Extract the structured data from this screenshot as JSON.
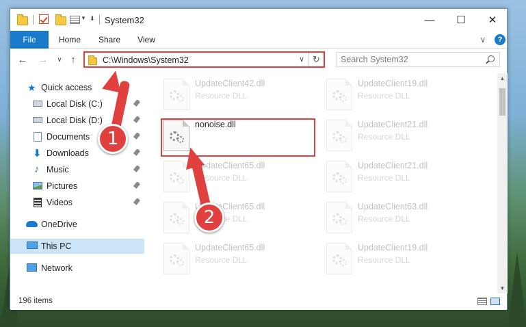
{
  "window": {
    "title": "System32",
    "controls": {
      "minimize": "—",
      "maximize": "☐",
      "close": "✕"
    }
  },
  "ribbon": {
    "tabs": [
      "File",
      "Home",
      "Share",
      "View"
    ],
    "collapse": "∨",
    "help": "?"
  },
  "nav": {
    "back": "←",
    "forward": "→",
    "recent": "∨",
    "up": "↑",
    "address": "C:\\Windows\\System32",
    "address_dropdown": "∨",
    "refresh": "↻",
    "search_placeholder": "Search System32"
  },
  "sidebar": {
    "items": [
      {
        "label": "Quick access",
        "icon": "star-icon",
        "pinned": false
      },
      {
        "label": "Local Disk (C:)",
        "icon": "drive-icon",
        "pinned": true
      },
      {
        "label": "Local Disk (D:)",
        "icon": "drive-icon",
        "pinned": true
      },
      {
        "label": "Documents",
        "icon": "documents-icon",
        "pinned": true
      },
      {
        "label": "Downloads",
        "icon": "download-icon",
        "pinned": true
      },
      {
        "label": "Music",
        "icon": "music-icon",
        "pinned": true
      },
      {
        "label": "Pictures",
        "icon": "pictures-icon",
        "pinned": true
      },
      {
        "label": "Videos",
        "icon": "videos-icon",
        "pinned": true
      },
      {
        "label": "OneDrive",
        "icon": "cloud-icon",
        "pinned": false
      },
      {
        "label": "This PC",
        "icon": "computer-icon",
        "pinned": false,
        "selected": true
      },
      {
        "label": "Network",
        "icon": "network-icon",
        "pinned": false
      }
    ]
  },
  "files": [
    {
      "name": "UpdateClient42.dll",
      "desc": "Resource DLL",
      "faded": true
    },
    {
      "name": "UpdateClient19.dll",
      "desc": "Resource DLL",
      "faded": true
    },
    {
      "name": "nonoise.dll",
      "desc": "",
      "faded": false
    },
    {
      "name": "UpdateClient21.dll",
      "desc": "Resource DLL",
      "faded": true
    },
    {
      "name": "UpdateClient65.dll",
      "desc": "Resource DLL",
      "faded": true
    },
    {
      "name": "UpdateClient21.dll",
      "desc": "Resource DLL",
      "faded": true
    },
    {
      "name": "UpdateClient65.dll",
      "desc": "Resource DLL",
      "faded": true
    },
    {
      "name": "UpdateClient63.dll",
      "desc": "Resource DLL",
      "faded": true
    },
    {
      "name": "UpdateClient65.dll",
      "desc": "Resource DLL",
      "faded": true
    },
    {
      "name": "UpdateClient19.dll",
      "desc": "Resource DLL",
      "faded": true
    }
  ],
  "status": {
    "item_count": "196 items"
  },
  "annotations": {
    "step1": "1",
    "step2": "2",
    "color": "#e0413f"
  },
  "colors": {
    "accent": "#1979ca",
    "selection": "#cce4f7"
  }
}
